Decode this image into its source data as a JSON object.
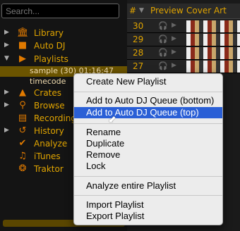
{
  "search": {
    "placeholder": "Search..."
  },
  "tree": {
    "items": [
      {
        "label": "Library",
        "icon": "library-icon",
        "arrow": "▶"
      },
      {
        "label": "Auto DJ",
        "icon": "autodj-icon",
        "arrow": "▶"
      },
      {
        "label": "Playlists",
        "icon": "playlist-icon",
        "arrow": "▼"
      },
      {
        "label": "Crates",
        "icon": "crates-icon",
        "arrow": "▶"
      },
      {
        "label": "Browse",
        "icon": "browse-icon",
        "arrow": "▶"
      },
      {
        "label": "Recording",
        "icon": "recording-icon",
        "arrow": ""
      },
      {
        "label": "History",
        "icon": "history-icon",
        "arrow": "▶"
      },
      {
        "label": "Analyze",
        "icon": "analyze-icon",
        "arrow": ""
      },
      {
        "label": "iTunes",
        "icon": "itunes-icon",
        "arrow": ""
      },
      {
        "label": "Traktor",
        "icon": "traktor-icon",
        "arrow": ""
      }
    ],
    "sub_items": [
      "sample (30) 01:16:47",
      "timecode"
    ]
  },
  "list": {
    "headers": {
      "num": "#",
      "preview": "Preview",
      "cover": "Cover Art"
    },
    "rows": [
      "30",
      "29",
      "28",
      "27"
    ]
  },
  "menu": {
    "items": [
      "Create New Playlist",
      "Add to Auto DJ Queue (bottom)",
      "Add to Auto DJ Queue (top)",
      "Rename",
      "Duplicate",
      "Remove",
      "Lock",
      "Analyze entire Playlist",
      "Import Playlist",
      "Export Playlist"
    ],
    "highlighted": "Add to Auto DJ Queue (top)"
  },
  "colors": {
    "accent": "#e0a400",
    "highlight": "#2a5fd6"
  }
}
